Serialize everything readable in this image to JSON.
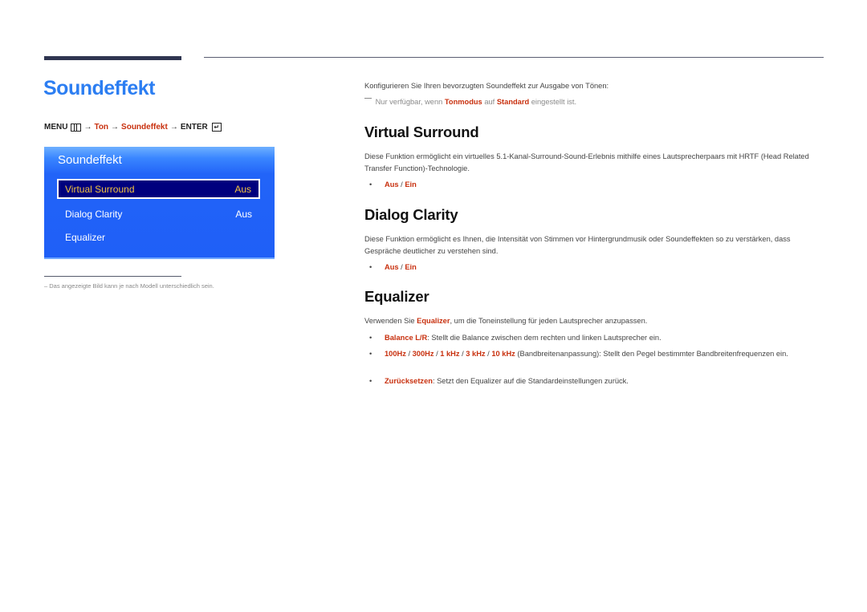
{
  "page": {
    "title": "Soundeffekt",
    "menu_path": {
      "menu_label": "MENU",
      "menu_icon": "menu-grid-icon",
      "arrow": "→",
      "steps": [
        "Ton",
        "Soundeffekt"
      ],
      "enter_label": "ENTER",
      "enter_icon": "enter-return-icon"
    }
  },
  "osd_menu": {
    "title": "Soundeffekt",
    "items": [
      {
        "label": "Virtual Surround",
        "value": "Aus",
        "selected": true
      },
      {
        "label": "Dialog Clarity",
        "value": "Aus",
        "selected": false
      },
      {
        "label": "Equalizer",
        "value": "",
        "selected": false
      }
    ]
  },
  "footnote": {
    "dash": "–",
    "text": "Das angezeigte Bild kann je nach Modell unterschiedlich sein."
  },
  "intro": {
    "text": "Konfigurieren Sie Ihren bevorzugten Soundeffekt zur Ausgabe von Tönen:",
    "note_prefix": "Nur verfügbar, wenn",
    "note_term1": "Tonmodus",
    "note_mid": "auf",
    "note_term2": "Standard",
    "note_suffix": "eingestellt ist."
  },
  "sections": {
    "virtual_surround": {
      "heading": "Virtual Surround",
      "description": "Diese Funktion ermöglicht ein virtuelles 5.1-Kanal-Surround-Sound-Erlebnis mithilfe eines Lautsprecherpaars mit HRTF (Head Related Transfer Function)-Technologie.",
      "options": [
        "Aus",
        "Ein"
      ],
      "separator": " / "
    },
    "dialog_clarity": {
      "heading": "Dialog Clarity",
      "description": "Diese Funktion ermöglicht es Ihnen, die Intensität von Stimmen vor Hintergrundmusik oder Soundeffekten so zu verstärken, dass Gespräche deutlicher zu verstehen sind.",
      "options": [
        "Aus",
        "Ein"
      ],
      "separator": " / "
    },
    "equalizer": {
      "heading": "Equalizer",
      "desc_prefix": "Verwenden Sie",
      "desc_term": "Equalizer",
      "desc_suffix": ", um die Toneinstellung für jeden Lautsprecher anzupassen.",
      "bullets": [
        {
          "term": "Balance L/R",
          "text": ": Stellt die Balance zwischen dem rechten und linken Lautsprecher ein."
        },
        {
          "terms": [
            "100Hz",
            "300Hz",
            "1 kHz",
            "3 kHz",
            "10 kHz"
          ],
          "separator": " / ",
          "text": " (Bandbreitenanpassung): Stellt den Pegel bestimmter Bandbreitenfrequenzen ein."
        },
        {
          "term": "Zurücksetzen",
          "text": ": Setzt den Equalizer auf die Standardeinstellungen zurück."
        }
      ]
    }
  },
  "bullet_glyph": "•",
  "colors": {
    "title_blue": "#2c7ef2",
    "emphasis_red": "#c8300e",
    "osd_blue": "#1f5ff7",
    "osd_selected_bg": "#00007e",
    "osd_selected_text": "#f2c240"
  }
}
